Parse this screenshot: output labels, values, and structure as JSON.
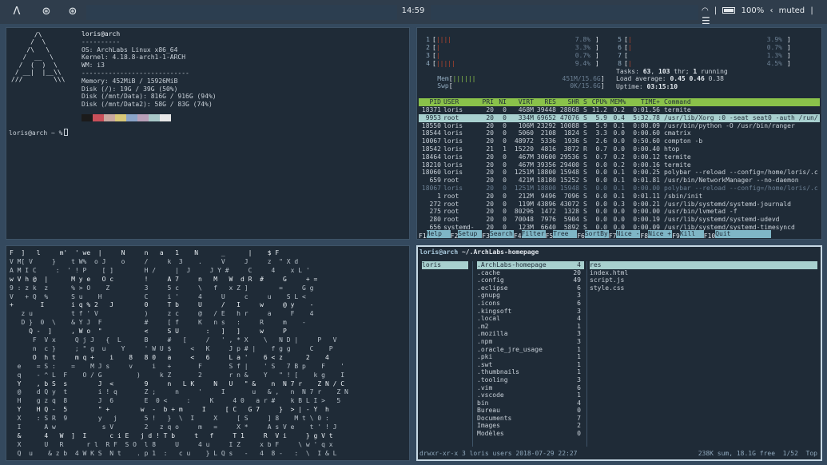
{
  "topbar": {
    "clock": "14:59",
    "battery": "100%",
    "volume": "muted",
    "volume_glyph": "‹",
    "wifi_glyph": "◠",
    "logo_glyph": "Λ",
    "app_glyph": "⊛",
    "menu_glyph": "☰"
  },
  "neofetch": {
    "logo": "      /\\\n     /  \\\n    /\\   \\\n   /  __  \\\n  /  (  )  \\\n / __|  |__\\\\\n///        \\\\\\",
    "lines": [
      "loris@arch",
      "----------",
      "OS: ArchLabs Linux x86_64",
      "Kernel: 4.18.8-arch1-1-ARCH",
      "WM: i3",
      "----------------------------",
      "Memory: 452MiB / 15926MiB",
      "Disk (/): 19G / 39G (50%)",
      "Disk (/mnt/Data): 816G / 916G (94%)",
      "Disk (/mnt/Data2): 58G / 83G (74%)"
    ],
    "swatches": [
      "#1b1b1b",
      "#c9505a",
      "#c8a8a0",
      "#d8c878",
      "#8aa4c8",
      "#b8a0b8",
      "#a8c8c8",
      "#e8e8e8"
    ],
    "prompt": "loris@arch ~ %"
  },
  "htop": {
    "cpus_left": [
      {
        "n": "1",
        "bar": "||||",
        "pct": "7.8%"
      },
      {
        "n": "2",
        "bar": "|",
        "pct": "3.3%"
      },
      {
        "n": "3",
        "bar": "|",
        "pct": "0.7%"
      },
      {
        "n": "4",
        "bar": "|||||",
        "pct": "9.4%"
      }
    ],
    "cpus_right": [
      {
        "n": "5",
        "bar": "|",
        "pct": "3.9%"
      },
      {
        "n": "6",
        "bar": "|",
        "pct": "0.7%"
      },
      {
        "n": "7",
        "bar": "",
        "pct": "1.3%"
      },
      {
        "n": "8",
        "bar": "|",
        "pct": "4.5%"
      }
    ],
    "mem": {
      "label": "Mem",
      "bar": "||||||",
      "value": "451M/15.6G"
    },
    "swp": {
      "label": "Swp",
      "bar": "",
      "value": "0K/15.6G"
    },
    "tasks": {
      "label": "Tasks: ",
      "count": "63",
      "sep": ", ",
      "thr": "103",
      "thr_label": " thr; ",
      "running": "1",
      "running_label": " running"
    },
    "load": {
      "label": "Load average: ",
      "v1": "0.45",
      "v2": "0.46",
      "v3": "0.38"
    },
    "uptime": {
      "label": "Uptime: ",
      "value": "03:15:10"
    },
    "columns": {
      "pid": "PID",
      "user": "USER",
      "pri": "PRI",
      "ni": "NI",
      "virt": "VIRT",
      "res": "RES",
      "shr": "SHR",
      "s": "S",
      "cpu": "CPU%",
      "mem": "MEM%",
      "time": "TIME+",
      "cmd": "Command"
    },
    "processes": [
      {
        "pid": "18371",
        "user": "loris",
        "pri": "20",
        "ni": "0",
        "virt": "468M",
        "res": "39448",
        "shr": "28868",
        "s": "S",
        "cpu": "11.2",
        "mem": "0.2",
        "time": "0:01.56",
        "cmd": "termite"
      },
      {
        "pid": "9953",
        "user": "root",
        "pri": "20",
        "ni": "0",
        "virt": "334M",
        "res": "69652",
        "shr": "47076",
        "s": "S",
        "cpu": "5.9",
        "mem": "0.4",
        "time": "5:32.78",
        "cmd": "/usr/lib/Xorg :0 -seat seat0 -auth /run/"
      },
      {
        "pid": "18550",
        "user": "loris",
        "pri": "20",
        "ni": "0",
        "virt": "106M",
        "res": "23292",
        "shr": "10088",
        "s": "S",
        "cpu": "5.9",
        "mem": "0.1",
        "time": "0:00.09",
        "cmd": "/usr/bin/python -O /usr/bin/ranger"
      },
      {
        "pid": "18544",
        "user": "loris",
        "pri": "20",
        "ni": "0",
        "virt": "5060",
        "res": "2108",
        "shr": "1824",
        "s": "S",
        "cpu": "3.3",
        "mem": "0.0",
        "time": "0:00.60",
        "cmd": "cmatrix"
      },
      {
        "pid": "10067",
        "user": "loris",
        "pri": "20",
        "ni": "0",
        "virt": "48972",
        "res": "5336",
        "shr": "1936",
        "s": "S",
        "cpu": "2.6",
        "mem": "0.0",
        "time": "0:50.60",
        "cmd": "compton -b"
      },
      {
        "pid": "18542",
        "user": "loris",
        "pri": "21",
        "ni": "1",
        "virt": "15220",
        "res": "4816",
        "shr": "3872",
        "s": "R",
        "cpu": "0.7",
        "mem": "0.0",
        "time": "0:00.40",
        "cmd": "htop"
      },
      {
        "pid": "18464",
        "user": "loris",
        "pri": "20",
        "ni": "0",
        "virt": "467M",
        "res": "30600",
        "shr": "29536",
        "s": "S",
        "cpu": "0.7",
        "mem": "0.2",
        "time": "0:00.12",
        "cmd": "termite"
      },
      {
        "pid": "18210",
        "user": "loris",
        "pri": "20",
        "ni": "0",
        "virt": "467M",
        "res": "39356",
        "shr": "29400",
        "s": "S",
        "cpu": "0.0",
        "mem": "0.2",
        "time": "0:00.16",
        "cmd": "termite"
      },
      {
        "pid": "18060",
        "user": "loris",
        "pri": "20",
        "ni": "0",
        "virt": "1251M",
        "res": "18800",
        "shr": "15948",
        "s": "S",
        "cpu": "0.0",
        "mem": "0.1",
        "time": "0:00.25",
        "cmd": "polybar --reload --config=/home/loris/.c"
      },
      {
        "pid": "659",
        "user": "root",
        "pri": "20",
        "ni": "0",
        "virt": "421M",
        "res": "18180",
        "shr": "15252",
        "s": "S",
        "cpu": "0.0",
        "mem": "0.1",
        "time": "0:01.81",
        "cmd": "/usr/bin/NetworkManager --no-daemon"
      },
      {
        "pid": "18067",
        "user": "loris",
        "pri": "20",
        "ni": "0",
        "virt": "1251M",
        "res": "18800",
        "shr": "15948",
        "s": "S",
        "cpu": "0.0",
        "mem": "0.1",
        "time": "0:00.00",
        "cmd": "polybar --reload --config=/home/loris/.c",
        "dim": true
      },
      {
        "pid": "1",
        "user": "root",
        "pri": "20",
        "ni": "0",
        "virt": "212M",
        "res": "9496",
        "shr": "7096",
        "s": "S",
        "cpu": "0.0",
        "mem": "0.1",
        "time": "0:01.11",
        "cmd": "/sbin/init"
      },
      {
        "pid": "272",
        "user": "root",
        "pri": "20",
        "ni": "0",
        "virt": "119M",
        "res": "43896",
        "shr": "43072",
        "s": "S",
        "cpu": "0.0",
        "mem": "0.3",
        "time": "0:00.21",
        "cmd": "/usr/lib/systemd/systemd-journald"
      },
      {
        "pid": "275",
        "user": "root",
        "pri": "20",
        "ni": "0",
        "virt": "80296",
        "res": "1472",
        "shr": "1328",
        "s": "S",
        "cpu": "0.0",
        "mem": "0.0",
        "time": "0:00.00",
        "cmd": "/usr/bin/lvmetad -f"
      },
      {
        "pid": "280",
        "user": "root",
        "pri": "20",
        "ni": "0",
        "virt": "70048",
        "res": "7976",
        "shr": "5904",
        "s": "S",
        "cpu": "0.0",
        "mem": "0.0",
        "time": "0:00.19",
        "cmd": "/usr/lib/systemd/systemd-udevd"
      },
      {
        "pid": "656",
        "user": "systemd-",
        "pri": "20",
        "ni": "0",
        "virt": "123M",
        "res": "6640",
        "shr": "5892",
        "s": "S",
        "cpu": "0.0",
        "mem": "0.0",
        "time": "0:00.09",
        "cmd": "/usr/lib/systemd/systemd-timesyncd"
      }
    ],
    "fkeys": [
      {
        "key": "F1",
        "label": "Help"
      },
      {
        "key": "F2",
        "label": "Setup"
      },
      {
        "key": "F3",
        "label": "Search"
      },
      {
        "key": "F4",
        "label": "Filter"
      },
      {
        "key": "F5",
        "label": "Tree"
      },
      {
        "key": "F6",
        "label": "SortBy"
      },
      {
        "key": "F7",
        "label": "Nice -"
      },
      {
        "key": "F8",
        "label": "Nice +"
      },
      {
        "key": "F9",
        "label": "Kill"
      },
      {
        "key": "F10",
        "label": "Quit"
      }
    ]
  },
  "matrix": {
    "rows": [
      "F  ]   l     m'  ' we  |     N     n   a   1    N      _      |    $ F",
      "V M[ V     }    t W%  o J    o     /     k  3    .     V     J     z  \" X d",
      "A M I C     :  ' ! P    [ ]        H /     |  J     J Y #     C     4    x L '",
      "w V h @  |      M y e   O c        !     A 7     n   M   W  d R  #     G     + =",
      "9 : z k  z      % > O    Z         3     5 c     \\   f   x Z ]        =     G g",
      "V   + Q  %      S u    H           C     i '     4     U     c     u    S L <",
      "+       I       i q % 2   J        0     T b     U     /   I     w     @ y    -",
      "   z u          t f ' V            )     z c     @   / E   h r     a     F    4",
      "   D }  0  \\    & Y J  F           #     [ f     K   n s   :     R     m    -",
      "     Q -  ]     , W o  \"           <     S U       :   ]   ]     w     P",
      "      F  V x     Q j J   {  L      B     #   [     /   ' , * X    \\   N D |     P   V",
      "      n  c }     ; \" g  u    Y     ' W U $     <   K     J p # |    f g g     C    P",
      "      O  h t     m q +    i    8   8 0   a     <   6     L a '    6 < z      2    4",
      "  e    = S :    =    M J s     v     i   +       F       S f |    ' S   7 B p    F    '",
      "  q    - ^ L  F    O / G         )     k Z       2       r n &    Y   \" ! [    k g    I",
      "  Y    , b S  s        J  <        9     n   L K     N   U   \" &    n  N 7 r    Z N / C",
      "  @    d Q y  t        i ! q       Z ;     n     '     I       u   & ,   n  N 7 r    Z N",
      "  H    g z q  8        J  6        E  0 <     :     K     4 0   a r #    k B L I >   5",
      "  Y    H Q -  5        \" +        w  -  b + m     I     [ C   G 7     }  > | - Y  h",
      "  X    : S R  9        y   j       5 !   }  \\  I     X     [ S     ] 8    M t \\ 0 :",
      "  I      A w            s V        2   z q o     m   =     X *     A s V e    t ' ! J",
      "  &      4   W  ]  I      c i E   j d ! T b     t   f     T 1     R  V i     } g V t",
      "  X      U   R      r l  R F  S O  l 8     U     4 u     I Z     x b F     \\ w ' q x",
      "  Q  u    & z b  4 W K S  N t    . p 1  :   c u    } L Q s   -   4  8 -   :  \\  I & L"
    ]
  },
  "ranger": {
    "title_user": "loris@arch",
    "title_path": " ~/.ArchLabs-homepage",
    "parent": [
      {
        "name": "loris",
        "sel": true
      }
    ],
    "current": [
      {
        "name": ".ArchLabs-homepage",
        "count": "4",
        "sel": true
      },
      {
        "name": ".cache",
        "count": "20"
      },
      {
        "name": ".config",
        "count": "49"
      },
      {
        "name": ".eclipse",
        "count": "6"
      },
      {
        "name": ".gnupg",
        "count": "3"
      },
      {
        "name": ".icons",
        "count": "6"
      },
      {
        "name": ".kingsoft",
        "count": "3"
      },
      {
        "name": ".local",
        "count": "4"
      },
      {
        "name": ".m2",
        "count": "1"
      },
      {
        "name": ".mozilla",
        "count": "3"
      },
      {
        "name": ".npm",
        "count": "3"
      },
      {
        "name": ".oracle_jre_usage",
        "count": "1"
      },
      {
        "name": ".pki",
        "count": "1"
      },
      {
        "name": ".swt",
        "count": "1"
      },
      {
        "name": ".thumbnails",
        "count": "1"
      },
      {
        "name": ".tooling",
        "count": "3"
      },
      {
        "name": ".vim",
        "count": "6"
      },
      {
        "name": ".vscode",
        "count": "1"
      },
      {
        "name": "bin",
        "count": "4"
      },
      {
        "name": "Bureau",
        "count": "0"
      },
      {
        "name": "Documents",
        "count": "7"
      },
      {
        "name": "Images",
        "count": "2"
      },
      {
        "name": "Modèles",
        "count": "0"
      }
    ],
    "preview": [
      {
        "name": "res",
        "sel": true
      },
      {
        "name": "index.html"
      },
      {
        "name": "script.js"
      },
      {
        "name": "style.css"
      }
    ],
    "status_left": "drwxr-xr-x 3 loris users 2018-07-29 22:27",
    "status_right": "238K sum, 18.1G free  1/52  Top"
  }
}
